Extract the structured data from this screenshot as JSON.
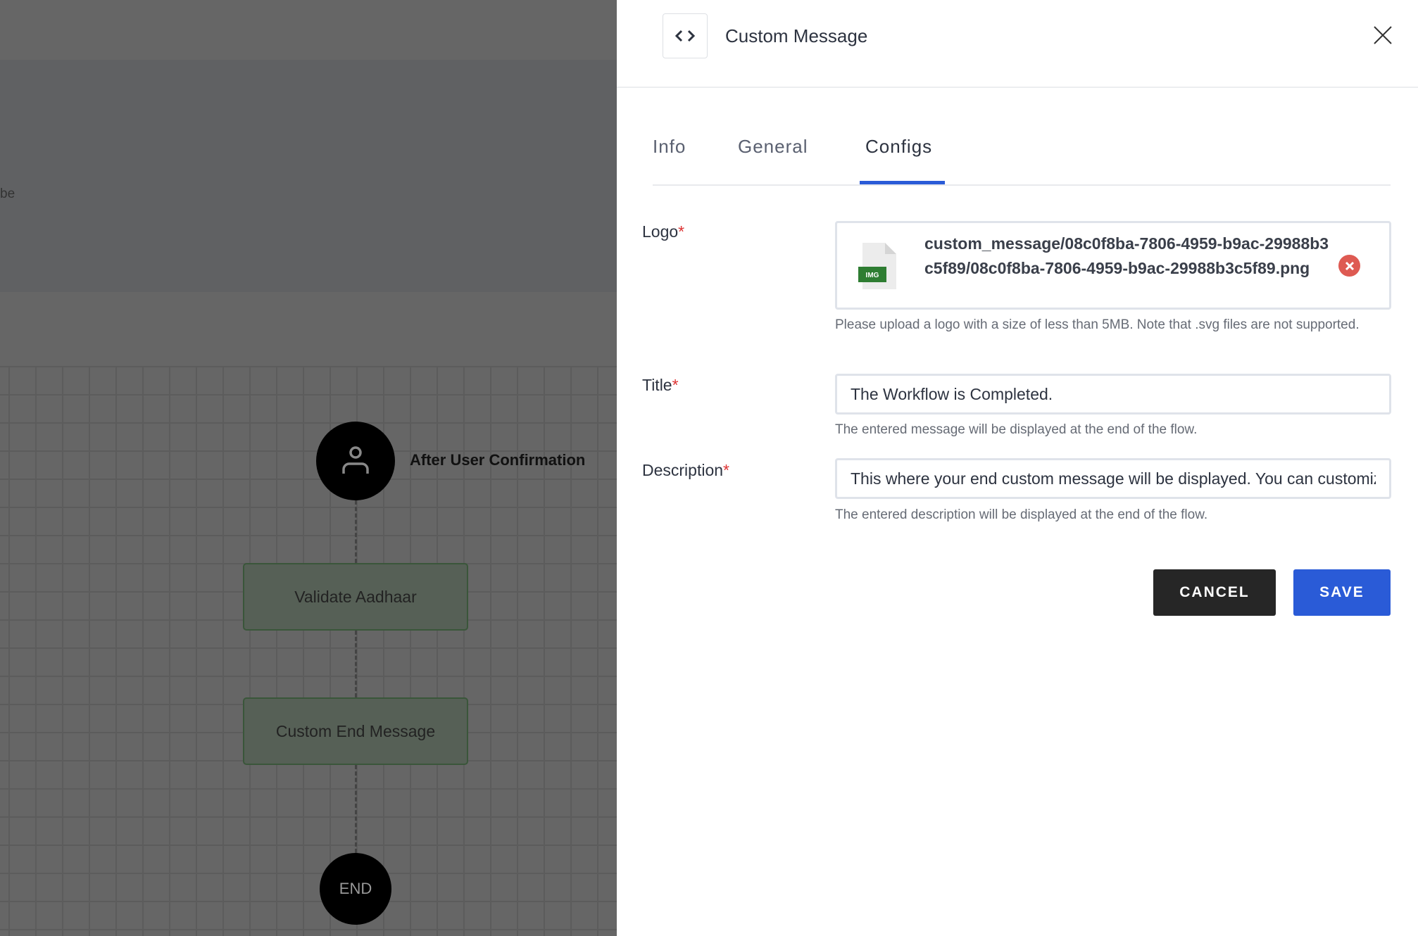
{
  "canvas": {
    "partial_text": "be",
    "nodes": [
      {
        "label": "After User Confirmation",
        "icon": "user-icon"
      },
      {
        "label": "Validate Aadhaar"
      },
      {
        "label": "Custom End Message"
      },
      {
        "label": "END"
      }
    ],
    "node_fill": "#566056"
  },
  "panel": {
    "icon": "code-icon",
    "title": "Custom Message",
    "close_icon": "close-icon",
    "tabs": [
      {
        "label": "Info",
        "active": false
      },
      {
        "label": "General",
        "active": false
      },
      {
        "label": "Configs",
        "active": true
      }
    ],
    "accent": "#2a5bd7",
    "form": {
      "logo": {
        "label": "Logo",
        "required": "*",
        "file_badge": "IMG",
        "file_name": "custom_message/08c0f8ba-7806-4959-b9ac-29988b3c5f89/08c0f8ba-7806-4959-b9ac-29988b3c5f89.png",
        "help": "Please upload a logo with a size of less than 5MB. Note that .svg files are not supported."
      },
      "title": {
        "label": "Title",
        "required": "*",
        "value": "The Workflow is Completed.",
        "help": "The entered message will be displayed at the end of the flow."
      },
      "description": {
        "label": "Description",
        "required": "*",
        "value": "This where your end custom message will be displayed. You can customize it",
        "help": "The entered description will be displayed at the end of the flow."
      }
    },
    "buttons": {
      "cancel": "CANCEL",
      "save": "SAVE"
    }
  }
}
